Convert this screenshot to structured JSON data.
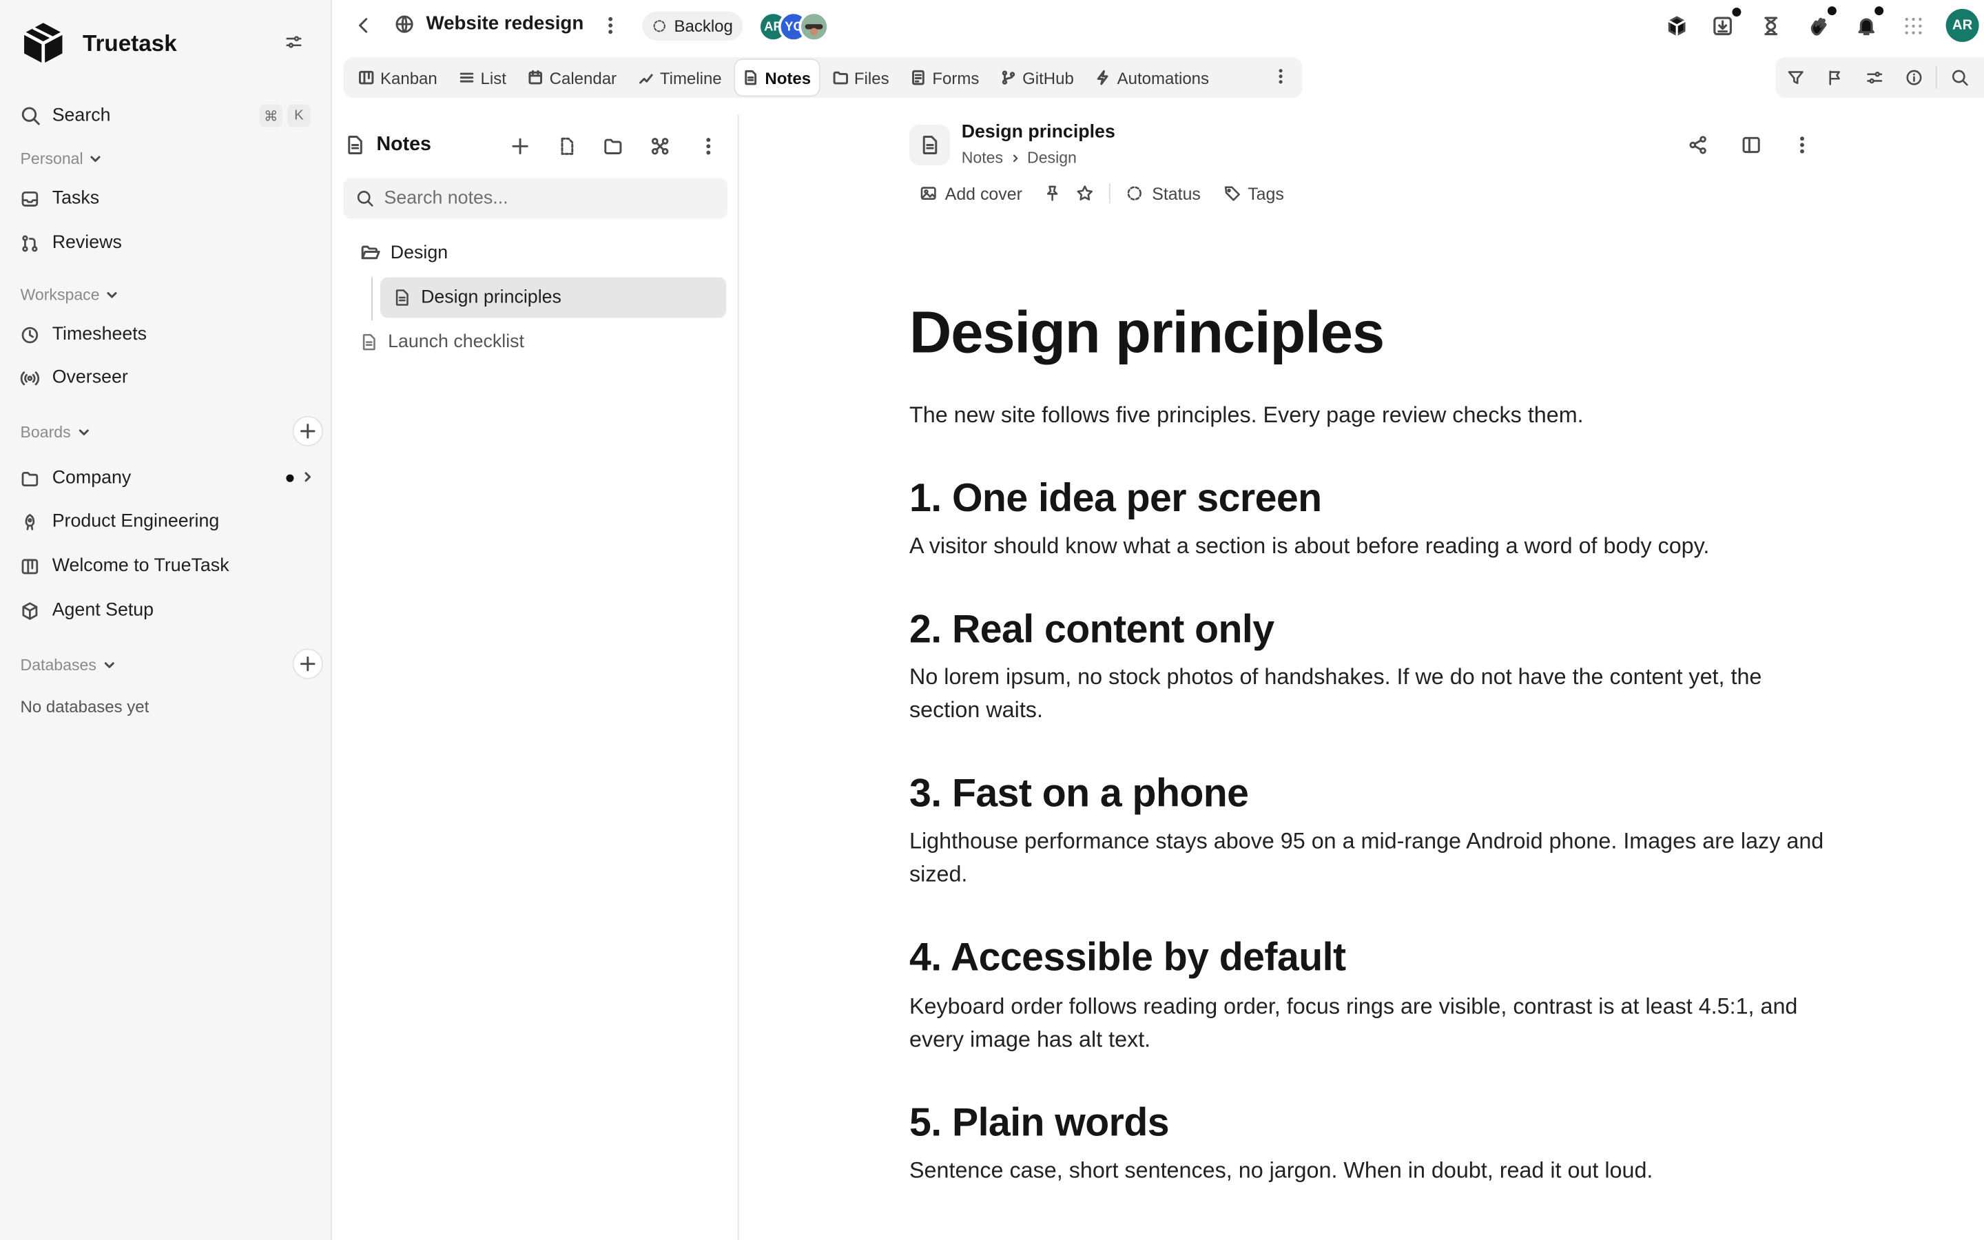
{
  "sidebar": {
    "brand": "Truetask",
    "search": {
      "label": "Search",
      "shortcut_mod": "⌘",
      "shortcut_key": "K"
    },
    "sections": {
      "personal": "Personal",
      "workspace": "Workspace",
      "boards": "Boards",
      "databases": "Databases"
    },
    "personal_items": [
      {
        "label": "Tasks",
        "icon": "inbox-icon"
      },
      {
        "label": "Reviews",
        "icon": "pull-request-icon"
      }
    ],
    "workspace_items": [
      {
        "label": "Timesheets",
        "icon": "clock-icon"
      },
      {
        "label": "Overseer",
        "icon": "broadcast-icon"
      }
    ],
    "board_items": [
      {
        "label": "Company",
        "icon": "folder-icon"
      },
      {
        "label": "Product Engineering",
        "icon": "rocket-icon"
      },
      {
        "label": "Welcome to TrueTask",
        "icon": "board-icon"
      },
      {
        "label": "Agent Setup",
        "icon": "package-icon"
      }
    ],
    "databases_empty": "No databases yet"
  },
  "topbar": {
    "page_name": "Website redesign",
    "status": "Backlog",
    "avatars": [
      {
        "initials": "AR",
        "color": "#17796a"
      },
      {
        "initials": "YC",
        "color": "#2f5fd6"
      },
      {
        "initials": "",
        "color": "#6a8f7b"
      }
    ],
    "me": "AR"
  },
  "views": [
    {
      "label": "Kanban",
      "icon": "kanban-icon"
    },
    {
      "label": "List",
      "icon": "list-icon"
    },
    {
      "label": "Calendar",
      "icon": "calendar-icon"
    },
    {
      "label": "Timeline",
      "icon": "timeline-icon"
    },
    {
      "label": "Notes",
      "icon": "note-icon",
      "active": true
    },
    {
      "label": "Files",
      "icon": "folder-icon"
    },
    {
      "label": "Forms",
      "icon": "form-icon"
    },
    {
      "label": "GitHub",
      "icon": "git-branch-icon"
    },
    {
      "label": "Automations",
      "icon": "bolt-icon"
    }
  ],
  "notes_panel": {
    "title": "Notes",
    "search_placeholder": "Search notes...",
    "tree": {
      "folder": "Design",
      "selected": "Design principles",
      "other": "Launch checklist"
    }
  },
  "doc": {
    "title": "Design principles",
    "breadcrumb": [
      "Notes",
      "Design"
    ],
    "add_cover": "Add cover",
    "status": "Status",
    "tags": "Tags",
    "heading": "Design principles",
    "lead": "The new site follows five principles. Every page review checks them.",
    "sections": [
      {
        "h": "1. One idea per screen",
        "p": "A visitor should know what a section is about before reading a word of body copy."
      },
      {
        "h": "2. Real content only",
        "p": "No lorem ipsum, no stock photos of handshakes. If we do not have the content yet, the section waits."
      },
      {
        "h": "3. Fast on a phone",
        "p": "Lighthouse performance stays above 95 on a mid-range Android phone. Images are lazy and sized."
      },
      {
        "h": "4. Accessible by default",
        "p": "Keyboard order follows reading order, focus rings are visible, contrast is at least 4.5:1, and every image has alt text."
      },
      {
        "h": "5. Plain words",
        "p": "Sentence case, short sentences, no jargon. When in doubt, read it out loud."
      }
    ]
  }
}
